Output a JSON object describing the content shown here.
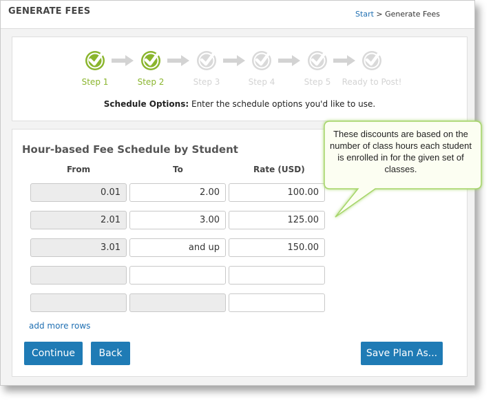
{
  "header": {
    "title": "GENERATE FEES",
    "breadcrumb": {
      "start": "Start",
      "separator": ">",
      "current": "Generate Fees"
    }
  },
  "steps": [
    {
      "label": "Step 1",
      "state": "complete"
    },
    {
      "label": "Step 2",
      "state": "complete"
    },
    {
      "label": "Step 3",
      "state": "pending"
    },
    {
      "label": "Step 4",
      "state": "pending"
    },
    {
      "label": "Step 5",
      "state": "pending"
    },
    {
      "label": "Ready to Post!",
      "state": "pending"
    }
  ],
  "schedule_options": {
    "label": "Schedule Options:",
    "text": "Enter the schedule options you'd like to use."
  },
  "fee_schedule": {
    "title": "Hour-based Fee Schedule by Student",
    "columns": [
      "From",
      "To",
      "Rate (USD)"
    ],
    "rows": [
      {
        "from": "0.01",
        "to": "2.00",
        "rate": "100.00"
      },
      {
        "from": "2.01",
        "to": "3.00",
        "rate": "125.00"
      },
      {
        "from": "3.01",
        "to": "and up",
        "rate": "150.00"
      },
      {
        "from": "",
        "to": "",
        "rate": ""
      },
      {
        "from": "",
        "to": "",
        "rate": ""
      }
    ],
    "add_more_label": "add more rows"
  },
  "buttons": {
    "continue": "Continue",
    "back": "Back",
    "save_plan": "Save Plan As..."
  },
  "callout": {
    "text": "These discounts are based on the number of class hours each student is enrolled in for the given set of classes."
  },
  "colors": {
    "accent_button": "#1f7bb5",
    "step_complete": "#8ab52d",
    "step_pending": "#d3d3d3",
    "link": "#1f6fb2",
    "callout_fill": "#fcfef2",
    "callout_border": "#a6d56a"
  }
}
